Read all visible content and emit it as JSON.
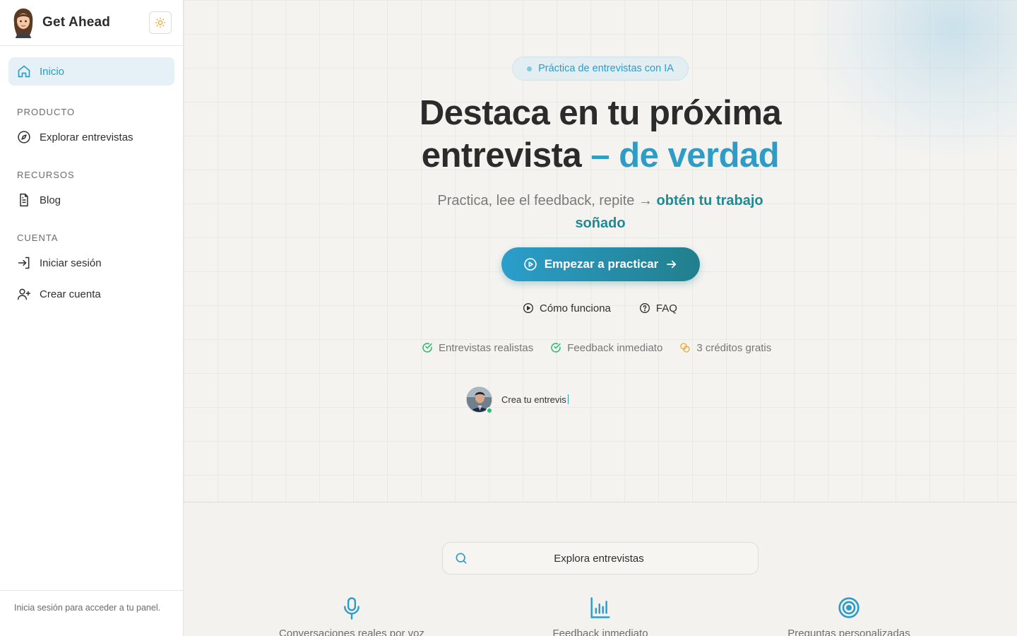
{
  "sidebar": {
    "brand_name": "Get Ahead",
    "theme_toggle_icon": "sun-icon",
    "home_label": "Inicio",
    "sections": [
      {
        "label": "PRODUCTO",
        "items": [
          {
            "label": "Explorar entrevistas",
            "icon": "compass-icon"
          }
        ]
      },
      {
        "label": "RECURSOS",
        "items": [
          {
            "label": "Blog",
            "icon": "document-icon"
          }
        ]
      },
      {
        "label": "CUENTA",
        "items": [
          {
            "label": "Iniciar sesión",
            "icon": "login-icon"
          },
          {
            "label": "Crear cuenta",
            "icon": "user-plus-icon"
          }
        ]
      }
    ],
    "footer_text": "Inicia sesión para acceder a tu panel."
  },
  "hero": {
    "pill": "Práctica de entrevistas con IA",
    "headline_main": "Destaca en tu próxima entrevista",
    "headline_accent": "– de verdad",
    "subline_main": "Practica, lee el feedback, repite →",
    "subline_strong": "obtén tu trabajo soñado",
    "cta": "Empezar a practicar",
    "links": [
      {
        "label": "Cómo funciona",
        "icon": "play-circle-icon"
      },
      {
        "label": "FAQ",
        "icon": "help-circle-icon"
      }
    ],
    "features": [
      {
        "label": "Entrevistas realistas",
        "icon": "check-circle-icon"
      },
      {
        "label": "Feedback inmediato",
        "icon": "check-circle-icon"
      },
      {
        "label": "3 créditos gratis",
        "icon": "coins-icon"
      }
    ],
    "chat_typing": "Crea tu entrevis"
  },
  "search": {
    "placeholder": "Explora entrevistas"
  },
  "tiles": [
    {
      "label": "Conversaciones reales por voz",
      "icon": "microphone-icon"
    },
    {
      "label": "Feedback inmediato",
      "icon": "bar-chart-icon"
    },
    {
      "label": "Preguntas personalizadas",
      "icon": "target-icon"
    }
  ],
  "colors": {
    "accent": "#2f9cc5",
    "teal": "#1f8a94",
    "success": "#23c36b",
    "coin": "#e8a93a"
  }
}
